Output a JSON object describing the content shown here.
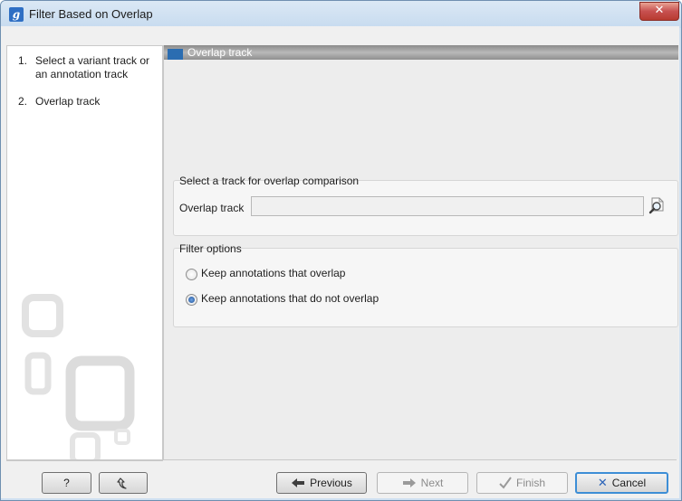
{
  "window": {
    "title": "Filter Based on Overlap",
    "app_icon_letter": "g",
    "close_glyph": "✕"
  },
  "steps": [
    {
      "number": "1.",
      "label": "Select a variant track or an annotation track"
    },
    {
      "number": "2.",
      "label": "Overlap track"
    }
  ],
  "main": {
    "header_title": "Overlap track",
    "track_group": {
      "title": "Select a track for overlap comparison",
      "field_label": "Overlap track",
      "field_value": "",
      "browse_icon": "browse-icon"
    },
    "filter_group": {
      "title": "Filter options",
      "options": [
        {
          "label": "Keep annotations that overlap",
          "checked": false
        },
        {
          "label": "Keep annotations that do not overlap",
          "checked": true
        }
      ]
    }
  },
  "footer": {
    "help_label": "?",
    "reset_icon": "reset-icon",
    "previous_label": "Previous",
    "next_label": "Next",
    "finish_label": "Finish",
    "cancel_label": "Cancel"
  },
  "colors": {
    "header_accent": "#2b6db1",
    "close_button": "#c75050",
    "default_button_border": "#3d8ed6"
  }
}
